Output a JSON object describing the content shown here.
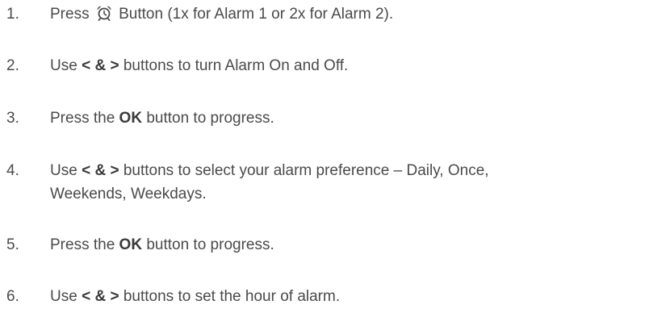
{
  "steps": [
    {
      "number": "1.",
      "before": "Press ",
      "icon": "alarm-clock-icon",
      "after": " Button (1x for Alarm 1 or 2x for Alarm 2)."
    },
    {
      "number": "2.",
      "before": "Use ",
      "bold": "< & >",
      "after": " buttons to turn Alarm On and Off."
    },
    {
      "number": "3.",
      "before": "Press the ",
      "bold": "OK",
      "after": " button to progress."
    },
    {
      "number": "4.",
      "before": "Use ",
      "bold": "< & >",
      "after": " buttons to select your alarm preference – Daily, Once,",
      "line2": "Weekends, Weekdays."
    },
    {
      "number": "5.",
      "before": "Press the ",
      "bold": "OK",
      "after": " button to progress."
    },
    {
      "number": "6.",
      "before": "Use ",
      "bold": "< & >",
      "after": " buttons to set the hour of alarm."
    }
  ]
}
